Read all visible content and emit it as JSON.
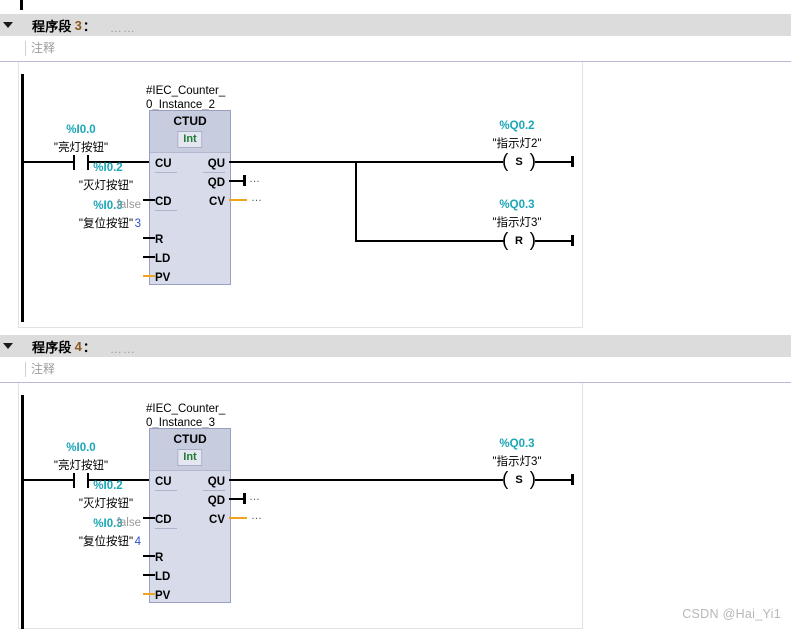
{
  "editor": {
    "watermark": "CSDN @Hai_Yi1"
  },
  "networks": [
    {
      "title": "程序段",
      "number": "3",
      "colon": "：",
      "dots": "……",
      "comment_placeholder": "注释",
      "instance_name_line1": "#IEC_Counter_",
      "instance_name_line2": "0_Instance_2",
      "block": {
        "name": "CTUD",
        "type": "Int",
        "inputs": [
          "CU",
          "CD",
          "R",
          "LD",
          "PV"
        ],
        "outputs": [
          "QU",
          "QD",
          "CV"
        ]
      },
      "contact": {
        "address": "%I0.0",
        "symbol": "\"亮灯按钮\"",
        "kind": "no-contact"
      },
      "operands": [
        {
          "pin": "CD",
          "address": "%I0.2",
          "symbol": "\"灭灯按钮\""
        },
        {
          "pin": "R",
          "address": "%I0.3",
          "symbol": "\"复位按钮\""
        }
      ],
      "literals": [
        {
          "pin": "LD",
          "value": "false",
          "style": "gray"
        },
        {
          "pin": "PV",
          "value": "3",
          "style": "blue"
        }
      ],
      "open_markers": [
        {
          "pin": "QD",
          "text": "…"
        },
        {
          "pin": "CV",
          "text": "…"
        }
      ],
      "coils": [
        {
          "address": "%Q0.2",
          "symbol": "\"指示灯2\"",
          "letter": "S"
        },
        {
          "address": "%Q0.3",
          "symbol": "\"指示灯3\"",
          "letter": "R"
        }
      ]
    },
    {
      "title": "程序段",
      "number": "4",
      "colon": "：",
      "dots": "……",
      "comment_placeholder": "注释",
      "instance_name_line1": "#IEC_Counter_",
      "instance_name_line2": "0_Instance_3",
      "block": {
        "name": "CTUD",
        "type": "Int",
        "inputs": [
          "CU",
          "CD",
          "R",
          "LD",
          "PV"
        ],
        "outputs": [
          "QU",
          "QD",
          "CV"
        ]
      },
      "contact": {
        "address": "%I0.0",
        "symbol": "\"亮灯按钮\"",
        "kind": "no-contact"
      },
      "operands": [
        {
          "pin": "CD",
          "address": "%I0.2",
          "symbol": "\"灭灯按钮\""
        },
        {
          "pin": "R",
          "address": "%I0.3",
          "symbol": "\"复位按钮\""
        }
      ],
      "literals": [
        {
          "pin": "LD",
          "value": "false",
          "style": "gray"
        },
        {
          "pin": "PV",
          "value": "4",
          "style": "blue"
        }
      ],
      "open_markers": [
        {
          "pin": "QD",
          "text": "…"
        },
        {
          "pin": "CV",
          "text": "…"
        }
      ],
      "coils": [
        {
          "address": "%Q0.3",
          "symbol": "\"指示灯3\"",
          "letter": "S"
        }
      ]
    }
  ],
  "colors": {
    "network_bar": "#dcdcdc",
    "block_body": "#d8dcea",
    "block_header": "#c7ccdf",
    "operand_address": "#1aa6b7",
    "network_number": "#8a5a20",
    "data_type": "#1f7a33",
    "literal_blue": "#2c52c9",
    "literal_gray": "#9a9a9a",
    "analog_wire": "#f2a31c",
    "comment_rule": "#b9b9d6"
  }
}
